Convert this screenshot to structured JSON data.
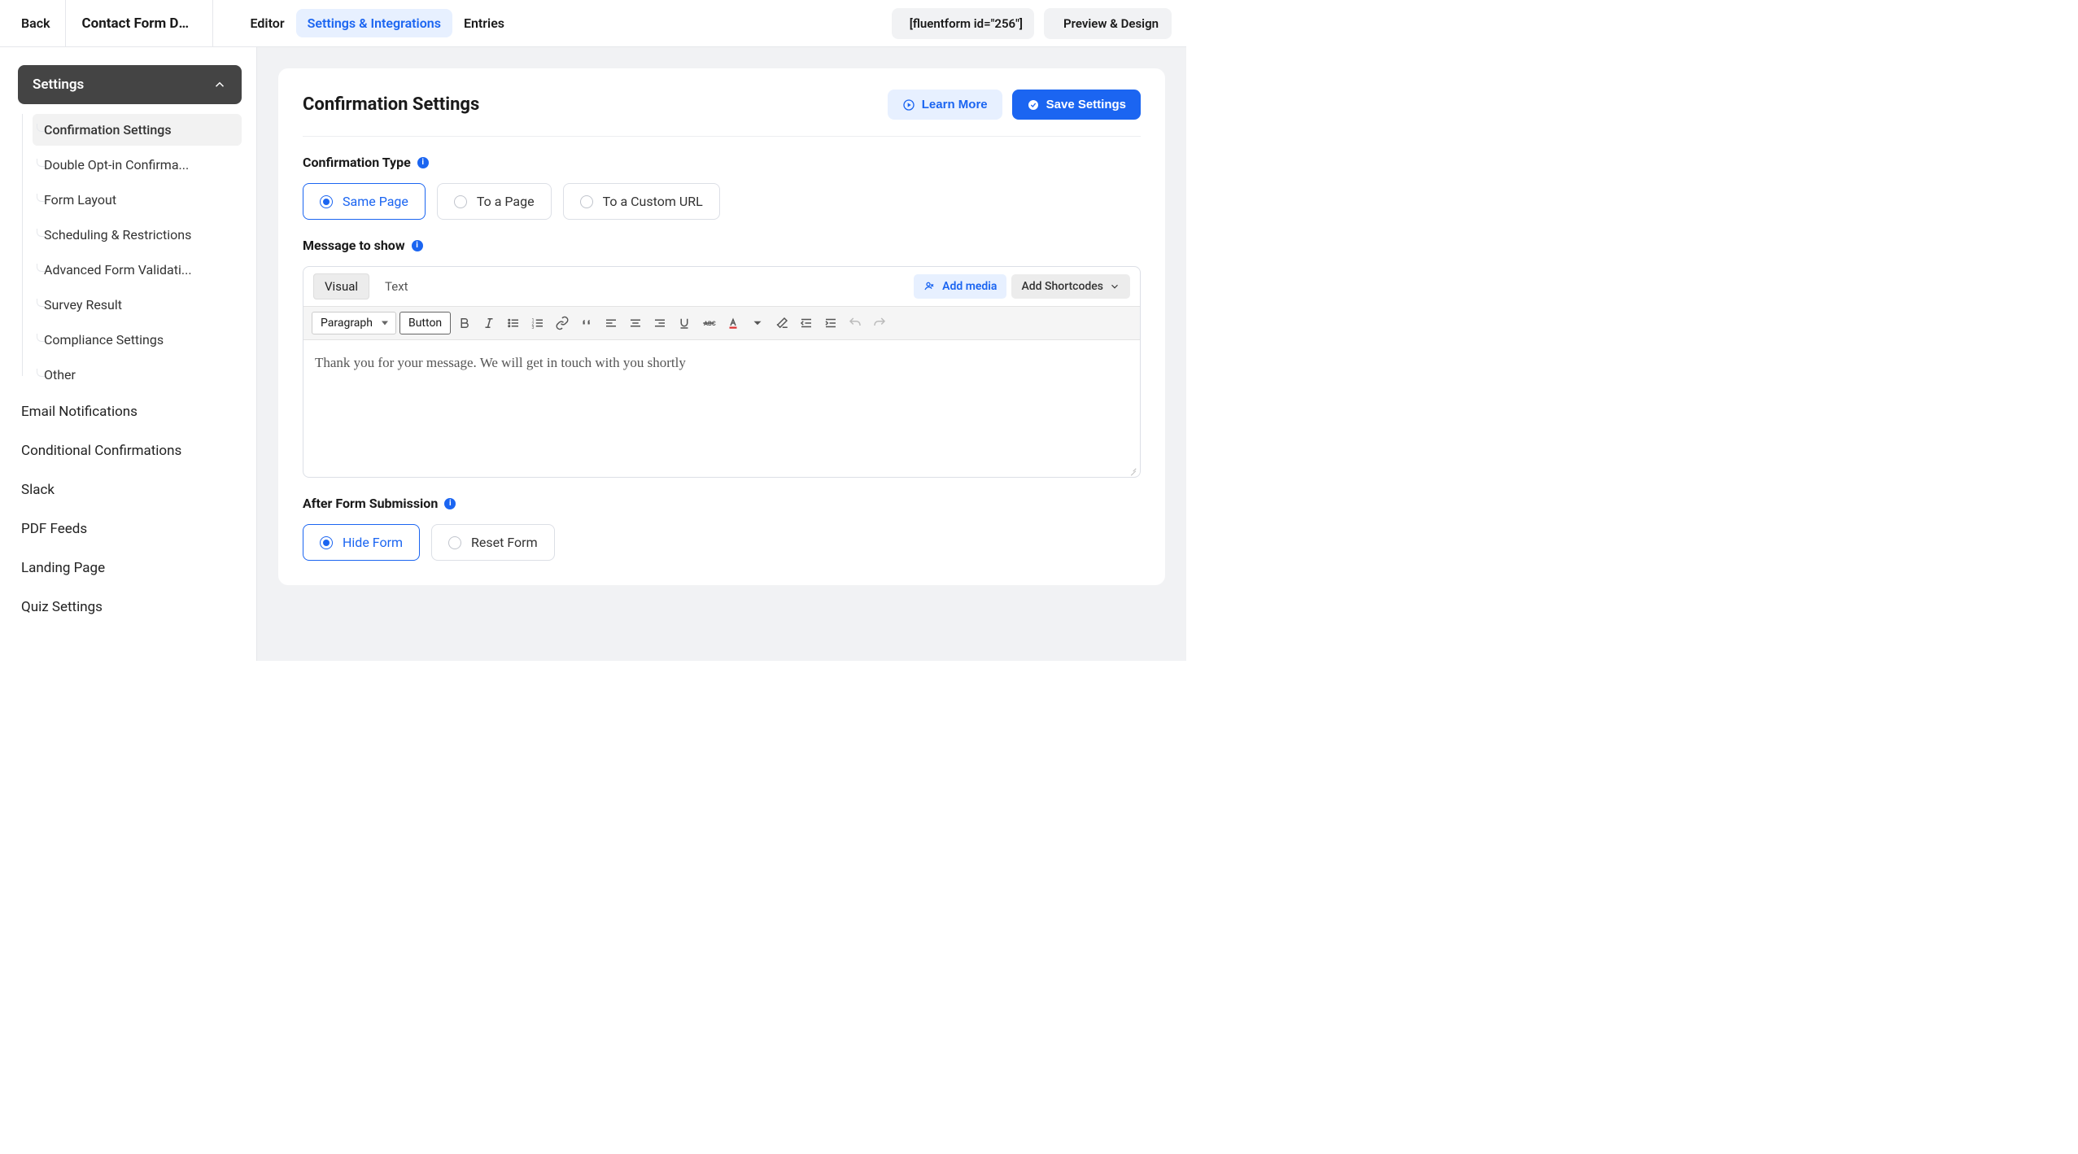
{
  "header": {
    "back_label": "Back",
    "form_title": "Contact Form De...",
    "tabs": [
      "Editor",
      "Settings & Integrations",
      "Entries"
    ],
    "active_tab": 1,
    "shortcode": "[fluentform id=\"256\"]",
    "preview_label": "Preview & Design"
  },
  "sidebar": {
    "section_label": "Settings",
    "sub_items": [
      "Confirmation Settings",
      "Double Opt-in Confirma...",
      "Form Layout",
      "Scheduling & Restrictions",
      "Advanced Form Validati...",
      "Survey Result",
      "Compliance Settings",
      "Other"
    ],
    "active_sub": 0,
    "items": [
      "Email Notifications",
      "Conditional Confirmations",
      "Slack",
      "PDF Feeds",
      "Landing Page",
      "Quiz Settings"
    ]
  },
  "panel": {
    "title": "Confirmation Settings",
    "learn_more": "Learn More",
    "save": "Save Settings"
  },
  "confirmation_type": {
    "label": "Confirmation Type",
    "options": [
      "Same Page",
      "To a Page",
      "To a Custom URL"
    ],
    "selected": 0
  },
  "message": {
    "label": "Message to show",
    "tabs": [
      "Visual",
      "Text"
    ],
    "active_tab": 0,
    "add_media": "Add media",
    "add_shortcodes": "Add Shortcodes",
    "format_select": "Paragraph",
    "button_label": "Button",
    "body": "Thank you for your message. We will get in touch with you shortly"
  },
  "after_submission": {
    "label": "After Form Submission",
    "options": [
      "Hide Form",
      "Reset Form"
    ],
    "selected": 0
  }
}
